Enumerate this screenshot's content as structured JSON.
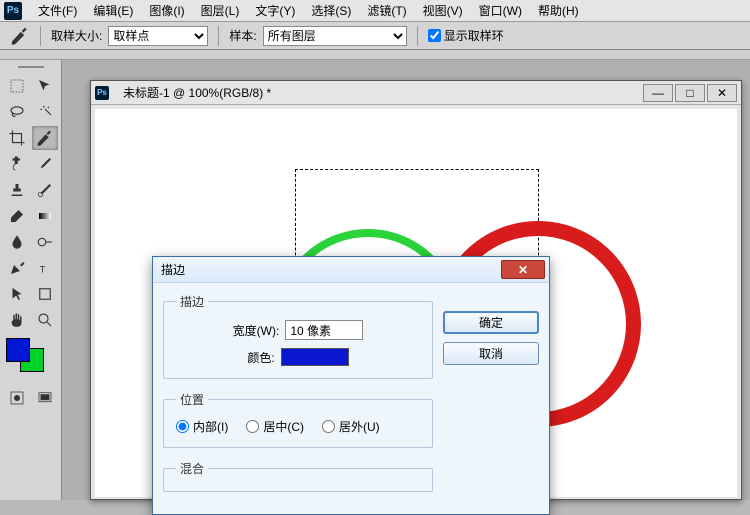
{
  "menu": {
    "file": "文件(F)",
    "edit": "编辑(E)",
    "image": "图像(I)",
    "layer": "图层(L)",
    "text": "文字(Y)",
    "select": "选择(S)",
    "filter": "滤镜(T)",
    "view": "视图(V)",
    "window": "窗口(W)",
    "help": "帮助(H)"
  },
  "options": {
    "sample_size_label": "取样大小:",
    "sample_size_value": "取样点",
    "sample_label": "样本:",
    "sample_value": "所有图层",
    "show_ring_label": "显示取样环"
  },
  "swatch": {
    "fg": "#0018d6",
    "bg": "#00d227"
  },
  "doc": {
    "title": "未标题-1 @ 100%(RGB/8) *"
  },
  "dialog": {
    "title": "描边",
    "ok": "确定",
    "cancel": "取消",
    "group_stroke": "描边",
    "width_label": "宽度(W):",
    "width_value": "10 像素",
    "color_label": "颜色:",
    "color_value": "#0a17cf",
    "group_pos": "位置",
    "pos_inside": "内部(I)",
    "pos_center": "居中(C)",
    "pos_outside": "居外(U)",
    "group_blend": "混合"
  }
}
